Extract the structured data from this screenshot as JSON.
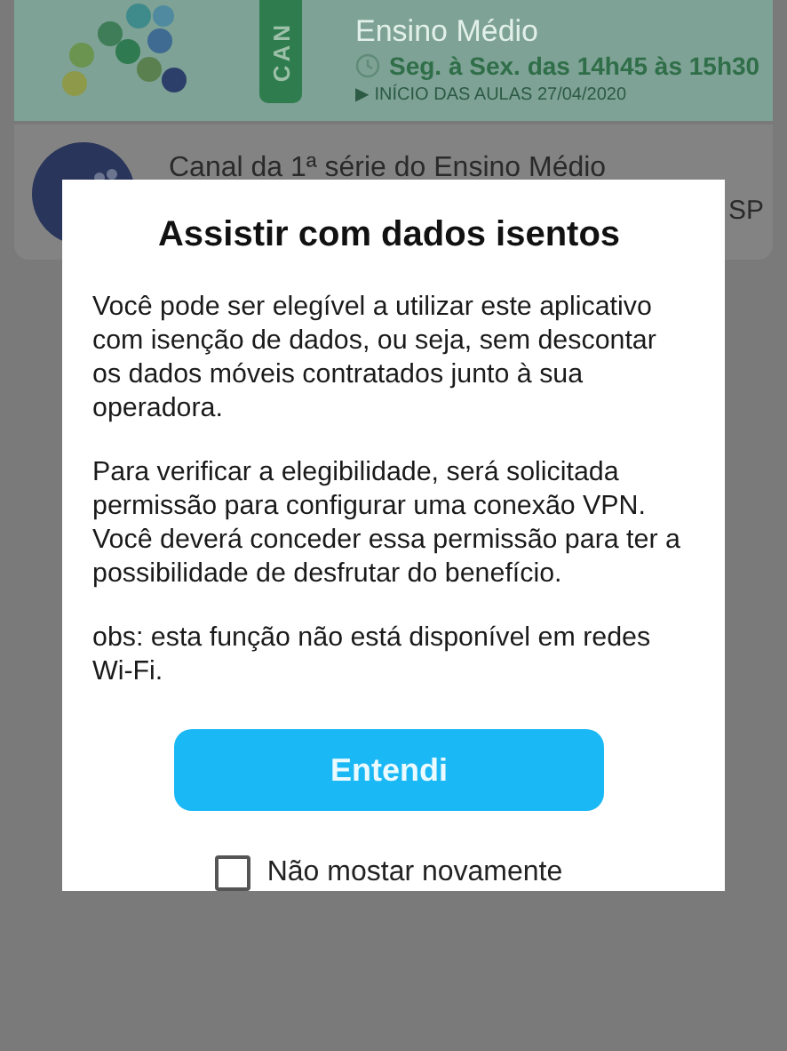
{
  "banner": {
    "tag": "CAN",
    "subtitle": "Ensino Médio",
    "schedule": "Seg. à Sex. das 14h45 às 15h30",
    "start_date": "▶ INÍCIO DAS AULAS 27/04/2020"
  },
  "channel": {
    "title": "Canal da 1ª série do Ensino Médio",
    "trailing": "SP"
  },
  "dialog": {
    "title": "Assistir com dados isentos",
    "paragraphs": [
      "Você pode ser elegível a utilizar este aplicativo com isenção de dados, ou seja, sem descontar os dados móveis contratados junto à sua operadora.",
      "Para verificar a elegibilidade, será solicitada permissão para configurar uma conexão VPN. Você deverá conceder essa permissão para ter a possibilidade de desfrutar do benefício.",
      "obs: esta função não está disponível em redes Wi-Fi."
    ],
    "button": "Entendi",
    "checkbox": {
      "label": "Não mostar novamente",
      "checked": false
    }
  }
}
